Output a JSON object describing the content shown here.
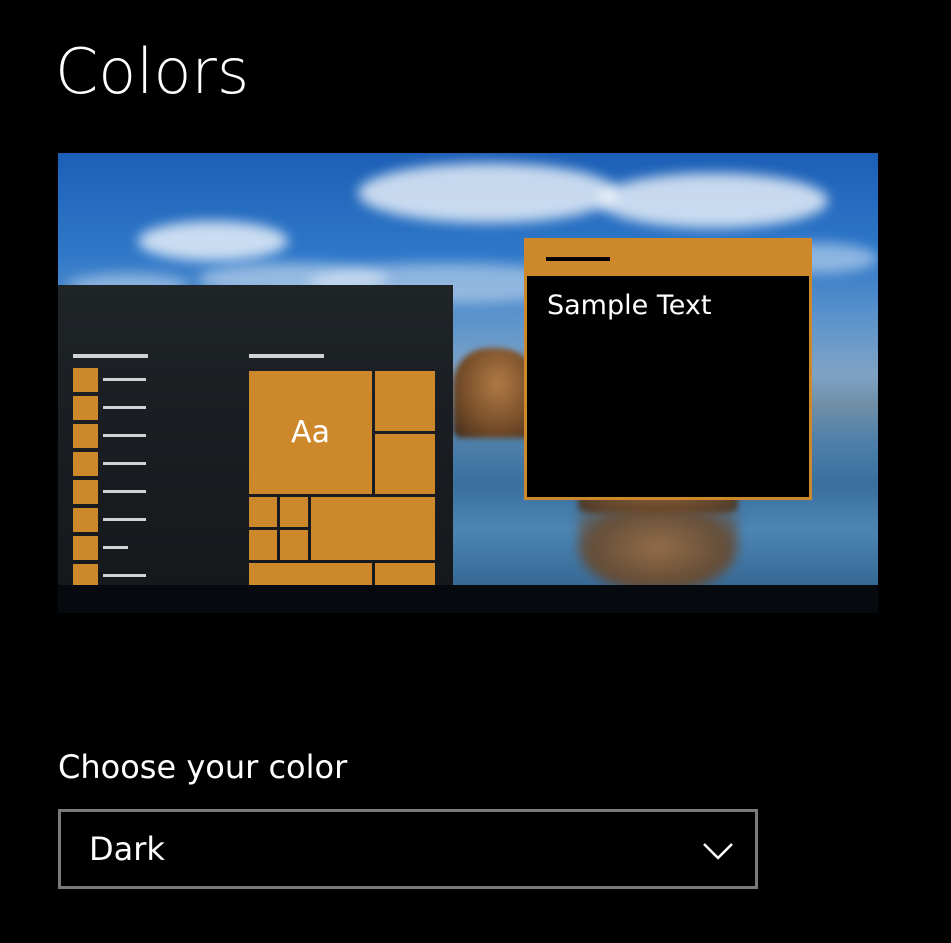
{
  "page": {
    "title": "Colors"
  },
  "preview": {
    "tile_label": "Aa",
    "window_sample_text": "Sample Text",
    "accent_color": "#cc882a"
  },
  "choose_color": {
    "label": "Choose your color",
    "selected": "Dark",
    "icon": "chevron-down-icon"
  }
}
